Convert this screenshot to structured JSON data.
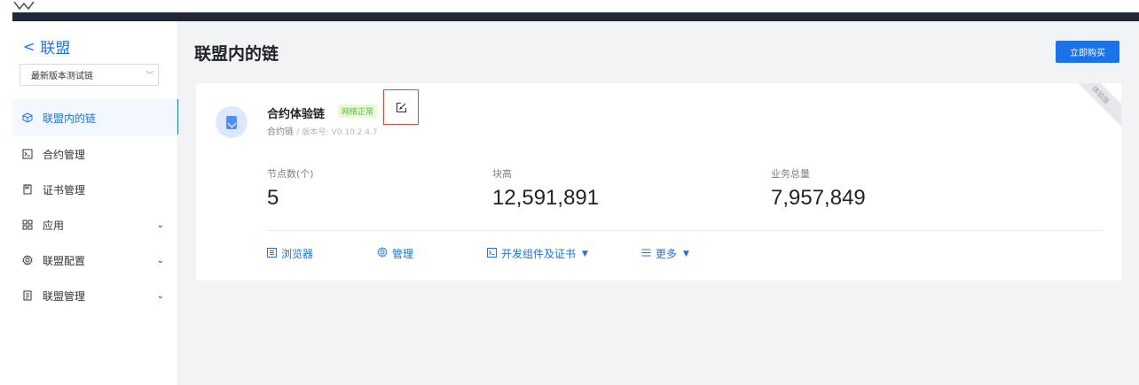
{
  "sidebar": {
    "back_label": "联盟",
    "chain_select": {
      "value": "最新版本测试链"
    },
    "items": [
      {
        "label": "联盟内的链",
        "icon": "cube-icon",
        "active": true
      },
      {
        "label": "合约管理",
        "icon": "terminal-icon"
      },
      {
        "label": "证书管理",
        "icon": "certificate-icon"
      },
      {
        "label": "应用",
        "icon": "apps-grid-icon",
        "expandable": true
      },
      {
        "label": "联盟配置",
        "icon": "gear-icon",
        "expandable": true
      },
      {
        "label": "联盟管理",
        "icon": "management-icon",
        "expandable": true
      }
    ]
  },
  "main": {
    "title": "联盟内的链",
    "buy_button": "立即购买"
  },
  "card": {
    "ribbon": "体验版",
    "chain_name": "合约体验链",
    "status": "网络正常",
    "type": "合约链",
    "separator": "/",
    "version_label": "版本号:",
    "version": "V0.10.2.4.7",
    "stats": [
      {
        "label": "节点数(个)",
        "value": "5"
      },
      {
        "label": "块高",
        "value": "12,591,891"
      },
      {
        "label": "业务总量",
        "value": "7,957,849"
      }
    ],
    "actions": [
      {
        "label": "浏览器",
        "icon": "browser-icon"
      },
      {
        "label": "管理",
        "icon": "gear-icon"
      },
      {
        "label": "开发组件及证书",
        "icon": "terminal-icon",
        "dropdown": true
      },
      {
        "label": "更多",
        "icon": "menu-icon",
        "dropdown": true
      }
    ]
  },
  "colors": {
    "primary": "#1a73e8",
    "status_bg": "#e9f8d8",
    "status_text": "#62b53c",
    "highlight_box": "#e2453c"
  }
}
